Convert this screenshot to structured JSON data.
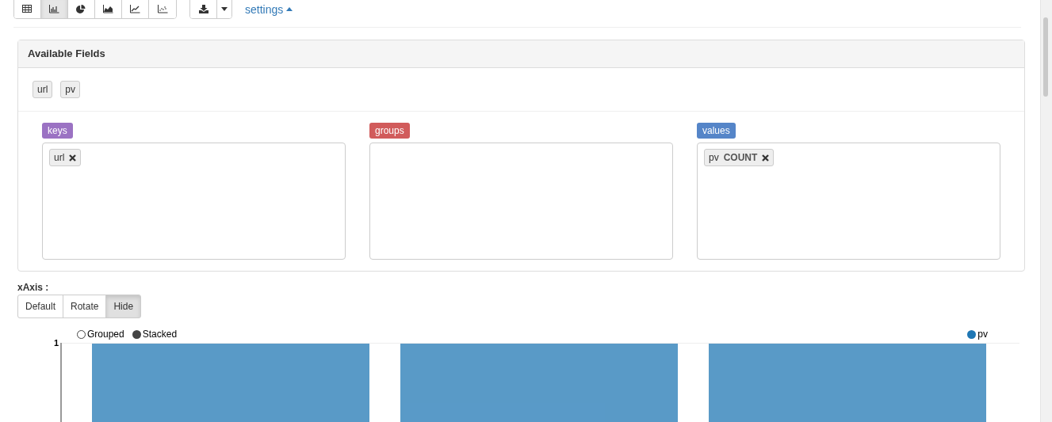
{
  "toolbar": {
    "chart_types": [
      {
        "kind": "table",
        "selected": false
      },
      {
        "kind": "bar",
        "selected": true
      },
      {
        "kind": "pie",
        "selected": false
      },
      {
        "kind": "area",
        "selected": false
      },
      {
        "kind": "line",
        "selected": false
      },
      {
        "kind": "scatter",
        "selected": false
      }
    ],
    "settings_link": "settings"
  },
  "available_fields": {
    "title": "Available Fields",
    "fields": [
      "url",
      "pv"
    ],
    "zones": [
      {
        "label": "keys",
        "color": "#9b72c3",
        "items": [
          {
            "text": "url"
          }
        ]
      },
      {
        "label": "groups",
        "color": "#d15b5b"
      },
      {
        "label": "values",
        "color": "#5585c8",
        "items": [
          {
            "text": "pv",
            "aggregation": "COUNT"
          }
        ]
      }
    ]
  },
  "x_axis": {
    "label": "xAxis :",
    "options": [
      {
        "label": "Default",
        "selected": false
      },
      {
        "label": "Rotate",
        "selected": false
      },
      {
        "label": "Hide",
        "selected": true
      }
    ]
  },
  "chart": {
    "modes": [
      {
        "label": "Grouped",
        "selected": false
      },
      {
        "label": "Stacked",
        "selected": true
      }
    ],
    "legend": [
      {
        "label": "pv",
        "color": "#1f77b4"
      }
    ],
    "y_tick": "1"
  }
}
